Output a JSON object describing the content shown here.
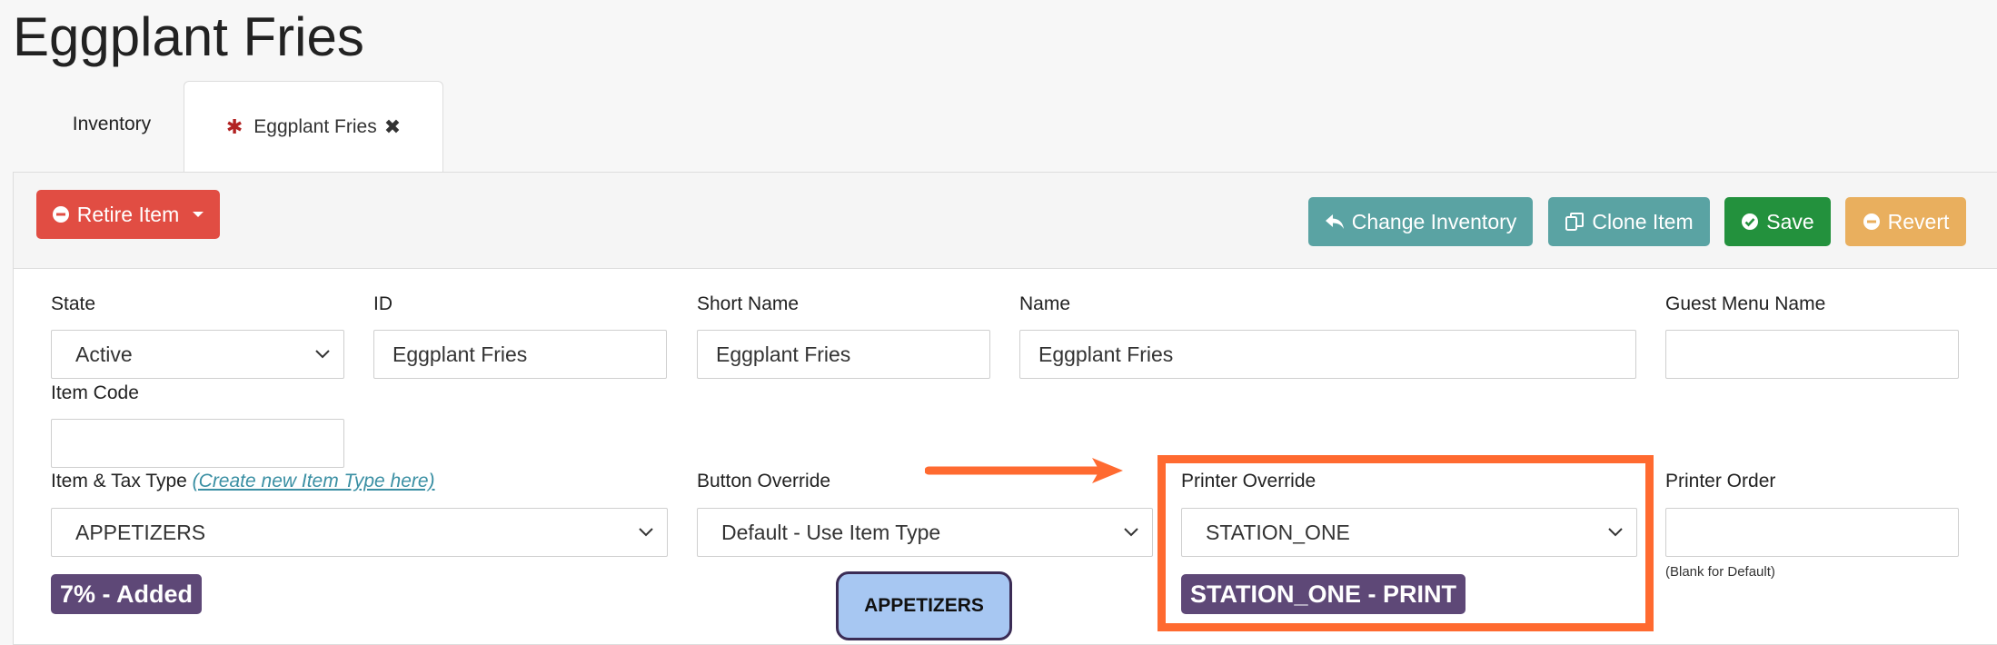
{
  "page": {
    "title": "Eggplant Fries"
  },
  "tabs": [
    {
      "label": "Inventory"
    },
    {
      "label": "Eggplant Fries",
      "modified_marker": "✱",
      "close_glyph": "✖"
    }
  ],
  "toolbar": {
    "retire_label": "Retire Item",
    "change_inventory_label": "Change Inventory",
    "clone_label": "Clone Item",
    "save_label": "Save",
    "revert_label": "Revert"
  },
  "form": {
    "state": {
      "label": "State",
      "value": "Active"
    },
    "id": {
      "label": "ID",
      "value": "Eggplant Fries"
    },
    "short_name": {
      "label": "Short Name",
      "value": "Eggplant Fries"
    },
    "name": {
      "label": "Name",
      "value": "Eggplant Fries"
    },
    "guest_menu_name": {
      "label": "Guest Menu Name",
      "value": ""
    },
    "item_code": {
      "label": "Item Code",
      "value": ""
    },
    "item_tax_type": {
      "label": "Item & Tax Type",
      "link": "(Create new Item Type here)",
      "value": "APPETIZERS",
      "tax_badge": "7% - Added"
    },
    "button_override": {
      "label": "Button Override",
      "value": "Default - Use Item Type",
      "preview": "APPETIZERS"
    },
    "printer_override": {
      "label": "Printer Override",
      "value": "STATION_ONE",
      "badge": "STATION_ONE - PRINT"
    },
    "printer_order": {
      "label": "Printer Order",
      "value": "",
      "hint": "(Blank for Default)"
    }
  },
  "colors": {
    "danger": "#e14d43",
    "info": "#5aa3a3",
    "success": "#23913d",
    "warning": "#e9af5e",
    "badge": "#5e4877",
    "annotation": "#ff6a30"
  }
}
